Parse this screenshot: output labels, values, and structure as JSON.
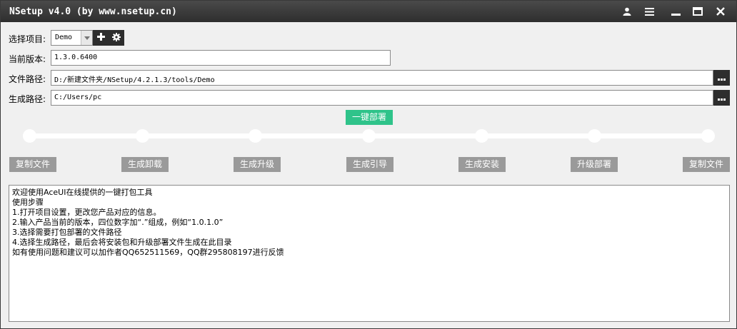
{
  "window": {
    "title": "NSetup v4.0 (by www.nsetup.cn)"
  },
  "titlebar_icons": [
    "user-icon",
    "menu-icon",
    "minimize-icon",
    "maximize-icon",
    "close-icon"
  ],
  "form": {
    "project_label": "选择项目:",
    "project_value": "Demo",
    "version_label": "当前版本:",
    "version_value": "1.3.0.6400",
    "file_path_label": "文件路径:",
    "file_path_value": "D:/新建文件夹/NSetup/4.2.1.3/tools/Demo",
    "output_path_label": "生成路径:",
    "output_path_value": "C:/Users/pc"
  },
  "deploy_button": "一键部署",
  "steps": [
    "复制文件",
    "生成卸载",
    "生成升级",
    "生成引导",
    "生成安装",
    "升级部署",
    "复制文件"
  ],
  "log_lines": [
    "欢迎使用AceUI在线提供的一键打包工具",
    "使用步骤",
    "1.打开项目设置，更改您产品对应的信息。",
    "2.输入产品当前的版本，四位数字加“.”组成，例如“1.0.1.0”",
    "3.选择需要打包部署的文件路径",
    "4.选择生成路径，最后会将安装包和升级部署文件生成在此目录",
    "如有使用问题和建议可以加作者QQ652511569，QQ群295808197进行反馈"
  ],
  "colors": {
    "titlebar": "#3a3a3a",
    "accent": "#2fc38a",
    "step_button": "#9a9a9a",
    "icon_button": "#2d2d2d"
  }
}
